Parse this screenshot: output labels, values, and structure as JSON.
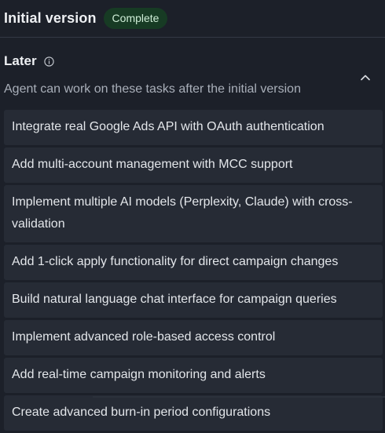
{
  "header": {
    "title": "Initial version",
    "status": "Complete"
  },
  "later": {
    "title": "Later",
    "info_icon": "info-circle-icon",
    "collapse_icon": "chevron-up-icon",
    "subtitle": "Agent can work on these tasks after the initial version",
    "tasks": [
      "Integrate real Google Ads API with OAuth authentication",
      "Add multi-account management with MCC support",
      "Implement multiple AI models (Perplexity, Claude) with cross-validation",
      "Add 1-click apply functionality for direct campaign changes",
      "Build natural language chat interface for campaign queries",
      "Implement advanced role-based access control",
      "Add real-time campaign monitoring and alerts",
      "Create advanced burn-in period configurations"
    ]
  },
  "colors": {
    "background": "#1c2029",
    "task_background": "#262b35",
    "badge_background": "#173b24",
    "badge_text": "#cfeed7",
    "muted_text": "#a9afb9"
  }
}
